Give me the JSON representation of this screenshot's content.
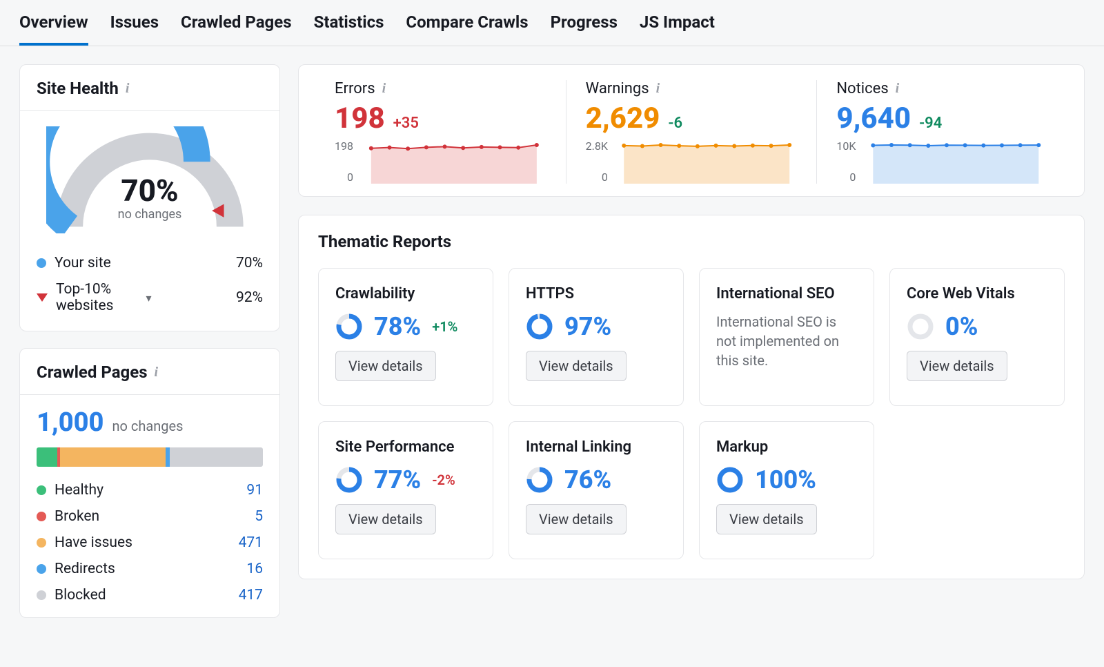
{
  "tabs": [
    "Overview",
    "Issues",
    "Crawled Pages",
    "Statistics",
    "Compare Crawls",
    "Progress",
    "JS Impact"
  ],
  "active_tab": 0,
  "site_health": {
    "title": "Site Health",
    "percent": "70%",
    "subtext": "no changes",
    "gauge_fraction": 0.7,
    "rows": [
      {
        "kind": "dot",
        "color": "#4aa3ea",
        "label": "Your site",
        "value": "70%"
      },
      {
        "kind": "tri",
        "label": "Top-10% websites",
        "value": "92%",
        "chev": true
      }
    ]
  },
  "crawled_pages": {
    "title": "Crawled Pages",
    "total": "1,000",
    "subtext": "no changes",
    "segments": [
      {
        "label": "Healthy",
        "value": "91",
        "color": "#3bbf7a",
        "w": 9.1
      },
      {
        "label": "Broken",
        "value": "5",
        "color": "#e45a55",
        "w": 1.5
      },
      {
        "label": "Have issues",
        "value": "471",
        "color": "#f4b560",
        "w": 47.1
      },
      {
        "label": "Redirects",
        "value": "16",
        "color": "#4aa3ea",
        "w": 1.6
      },
      {
        "label": "Blocked",
        "value": "417",
        "color": "#cfd1d6",
        "w": 41.7
      }
    ]
  },
  "stats": [
    {
      "key": "errors",
      "title": "Errors",
      "value": "198",
      "delta": "+35",
      "delta_class": "d-neg",
      "color": "#d1333a",
      "fill": "#f7d6d6",
      "ymax": "198",
      "ymin": "0",
      "points": [
        190,
        195,
        188,
        196,
        200,
        192,
        198,
        196,
        194,
        210
      ]
    },
    {
      "key": "warnings",
      "title": "Warnings",
      "value": "2,629",
      "delta": "-6",
      "delta_class": "d-pos",
      "color": "#f08c00",
      "fill": "#fbe4c7",
      "ymax": "2.8K",
      "ymin": "0",
      "points": [
        2650,
        2620,
        2700,
        2640,
        2600,
        2650,
        2620,
        2660,
        2640,
        2700
      ]
    },
    {
      "key": "notices",
      "title": "Notices",
      "value": "9,640",
      "delta": "-94",
      "delta_class": "d-pos",
      "color": "#2b80e6",
      "fill": "#d4e6f9",
      "ymax": "10K",
      "ymin": "0",
      "points": [
        9600,
        9700,
        9650,
        9500,
        9640,
        9620,
        9580,
        9600,
        9640,
        9680
      ]
    }
  ],
  "thematic": {
    "title": "Thematic Reports",
    "view_details": "View details",
    "cards": [
      {
        "title": "Crawlability",
        "percent": "78%",
        "frac": 0.78,
        "delta": "+1%",
        "delta_class": "d-pos",
        "ring": "#2b80e6"
      },
      {
        "title": "HTTPS",
        "percent": "97%",
        "frac": 0.97,
        "ring": "#2b80e6"
      },
      {
        "title": "International SEO",
        "message": "International SEO is not implemented on this site."
      },
      {
        "title": "Core Web Vitals",
        "percent": "0%",
        "frac": 0.0,
        "ring": "#cfd1d6"
      },
      {
        "title": "Site Performance",
        "percent": "77%",
        "frac": 0.77,
        "delta": "-2%",
        "delta_class": "d-neg",
        "ring": "#2b80e6"
      },
      {
        "title": "Internal Linking",
        "percent": "76%",
        "frac": 0.76,
        "ring": "#2b80e6"
      },
      {
        "title": "Markup",
        "percent": "100%",
        "frac": 1.0,
        "ring": "#2b80e6"
      }
    ]
  },
  "chart_data": [
    {
      "type": "line",
      "title": "Errors",
      "ylim": [
        0,
        198
      ],
      "y": [
        190,
        195,
        188,
        196,
        200,
        192,
        198,
        196,
        194,
        210
      ]
    },
    {
      "type": "line",
      "title": "Warnings",
      "ylim": [
        0,
        2800
      ],
      "y": [
        2650,
        2620,
        2700,
        2640,
        2600,
        2650,
        2620,
        2660,
        2640,
        2700
      ]
    },
    {
      "type": "line",
      "title": "Notices",
      "ylim": [
        0,
        10000
      ],
      "y": [
        9600,
        9700,
        9650,
        9500,
        9640,
        9620,
        9580,
        9600,
        9640,
        9680
      ]
    }
  ]
}
